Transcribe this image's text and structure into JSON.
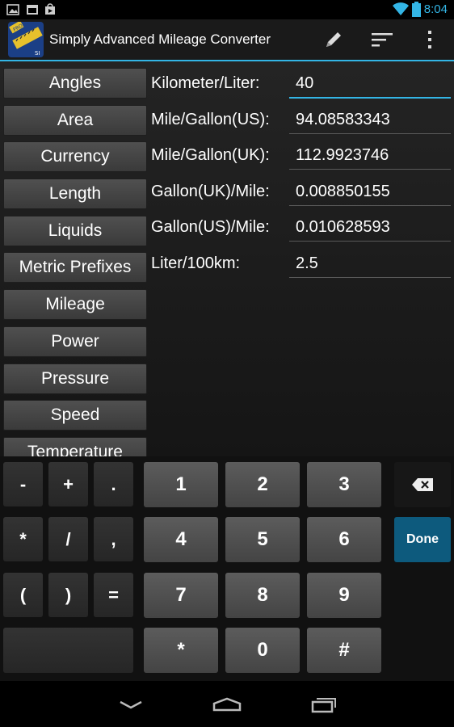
{
  "status_bar": {
    "time": "8:04",
    "icons": [
      "image-icon",
      "calendar-icon",
      "play-store-icon",
      "wifi-icon",
      "battery-icon"
    ]
  },
  "action_bar": {
    "title": "Simply Advanced Mileage Converter",
    "app_icon_badge_top": "PRO",
    "app_icon_badge_bottom": "SI",
    "actions": [
      "edit-icon",
      "sort-icon",
      "overflow-menu-icon"
    ],
    "accent_color": "#33b5e5"
  },
  "categories": [
    "Angles",
    "Area",
    "Currency",
    "Length",
    "Liquids",
    "Metric Prefixes",
    "Mileage",
    "Power",
    "Pressure",
    "Speed",
    "Temperature"
  ],
  "fields": [
    {
      "label": "Kilometer/Liter:",
      "value": "40",
      "active": true
    },
    {
      "label": "Mile/Gallon(US):",
      "value": "94.08583343",
      "active": false
    },
    {
      "label": "Mile/Gallon(UK):",
      "value": "112.9923746",
      "active": false
    },
    {
      "label": "Gallon(UK)/Mile:",
      "value": "0.008850155",
      "active": false
    },
    {
      "label": "Gallon(US)/Mile:",
      "value": "0.010628593",
      "active": false
    },
    {
      "label": "Liter/100km:",
      "value": "2.5",
      "active": false
    }
  ],
  "keypad": {
    "symbol_keys": [
      "-",
      "+",
      ".",
      "*",
      "/",
      ",",
      "(",
      ")",
      "="
    ],
    "digit_keys": [
      "1",
      "2",
      "3",
      "4",
      "5",
      "6",
      "7",
      "8",
      "9",
      "*",
      "0",
      "#"
    ],
    "backspace_icon": "backspace-icon",
    "done_label": "Done",
    "done_color": "#0d5a7d"
  },
  "nav_bar": [
    "back-icon",
    "home-icon",
    "recent-apps-icon"
  ]
}
